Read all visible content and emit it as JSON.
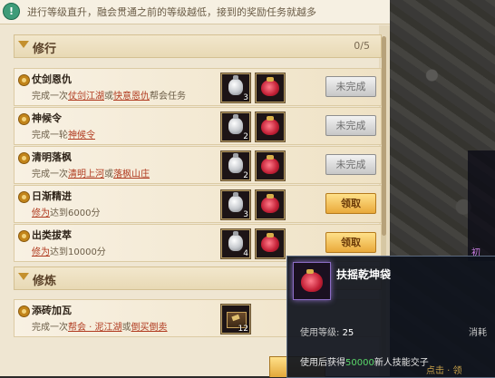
{
  "topbar": {
    "text": "进行等级直升，融会贯通之前的等级越低，接到的奖励任务就越多",
    "icon": "info-icon"
  },
  "sections": [
    {
      "title": "修行",
      "count": "0/5"
    },
    {
      "title": "修炼"
    }
  ],
  "rows": [
    {
      "title": "仗剑恩仇",
      "desc_prefix": "完成一次",
      "link1": "仗剑江湖",
      "mid": "或",
      "link2": "快意恩仇",
      "desc_suffix": "帮会任务",
      "item1_count": "3",
      "item2_count": "",
      "button": "未完成",
      "button_state": "done"
    },
    {
      "title": "神候令",
      "desc_prefix": "完成一轮",
      "link1": "神候令",
      "item1_count": "2",
      "item2_count": "",
      "button": "未完成",
      "button_state": "done"
    },
    {
      "title": "清明落枫",
      "desc_prefix": "完成一次",
      "link1": "清明上河",
      "mid": "或",
      "link2": "落枫山庄",
      "item1_count": "2",
      "item2_count": "",
      "button": "未完成",
      "button_state": "done"
    },
    {
      "title": "日渐精进",
      "link1": "修为",
      "desc_suffix": "达到6000分",
      "item1_count": "3",
      "item2_count": "",
      "button": "领取",
      "button_state": "claim"
    },
    {
      "title": "出类拔萃",
      "link1": "修为",
      "desc_suffix": "达到10000分",
      "item1_count": "4",
      "item2_count": "",
      "button": "领取",
      "button_state": "claim"
    },
    {
      "title": "添砖加瓦",
      "desc_prefix": "完成一次",
      "link1": "帮会 · 泥江湖",
      "mid": "或",
      "link2": "倒买倒卖",
      "item1_count": "12"
    }
  ],
  "tooltip": {
    "title": "扶摇乾坤袋",
    "level_label": "使用等级:",
    "level_value": "25",
    "consume_label": "消耗",
    "desc_prefix": "使用后获得",
    "desc_amount": "50000",
    "desc_suffix": "新人技能交子"
  },
  "world": {
    "text_a": "初",
    "text_b": "点击 · 领"
  }
}
